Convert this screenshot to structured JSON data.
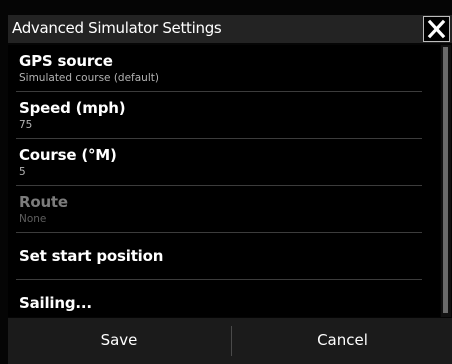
{
  "dialog": {
    "title": "Advanced Simulator Settings",
    "close_icon": "close-icon"
  },
  "settings": {
    "items": [
      {
        "label": "GPS source",
        "value": "Simulated course (default)",
        "enabled": true
      },
      {
        "label": "Speed (mph)",
        "value": "75",
        "enabled": true
      },
      {
        "label": "Course (°M)",
        "value": "5",
        "enabled": true
      },
      {
        "label": "Route",
        "value": "None",
        "enabled": false
      },
      {
        "label": "Set start position",
        "enabled": true
      },
      {
        "label": "Sailing...",
        "enabled": true
      }
    ]
  },
  "footer": {
    "save_label": "Save",
    "cancel_label": "Cancel"
  },
  "colors": {
    "background": "#000000",
    "titlebar": "#232323",
    "text": "#ffffff",
    "subtext": "#b3b3b3",
    "disabled_text": "#7c7c7c"
  }
}
